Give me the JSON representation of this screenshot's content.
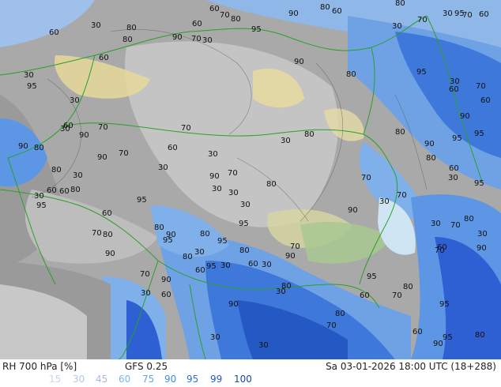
{
  "footer": {
    "title": "RH 700 hPa [%]",
    "model": "GFS 0.25",
    "valid_time": "Sa 03-01-2026 18:00 UTC (18+288)"
  },
  "legend": [
    {
      "label": "15",
      "color": "#c8d6ea"
    },
    {
      "label": "30",
      "color": "#b7c8e2"
    },
    {
      "label": "45",
      "color": "#a6bcdc"
    },
    {
      "label": "60",
      "color": "#7fb6ea"
    },
    {
      "label": "75",
      "color": "#5da6e8"
    },
    {
      "label": "90",
      "color": "#3f8ee0"
    },
    {
      "label": "95",
      "color": "#2f72d2"
    },
    {
      "label": "99",
      "color": "#2458c2"
    },
    {
      "label": "100",
      "color": "#1d44b0"
    }
  ],
  "palette": {
    "very_dry": "#d9d9d9",
    "dry": "#b8b8b8",
    "mid": "#9a9a9a",
    "moist": "#8fb8e8",
    "wet": "#4f86e0",
    "saturated": "#2e5fd3",
    "terrain_yellow": "#e8dca0",
    "terrain_green": "#a8c890",
    "borders": "#2aa02a"
  },
  "contour_labels": [
    "60",
    "70",
    "80",
    "90",
    "80",
    "60",
    "95",
    "60",
    "30",
    "60",
    "80",
    "90",
    "70",
    "30",
    "80",
    "70",
    "80",
    "30",
    "95",
    "70",
    "60",
    "30",
    "60",
    "90",
    "80",
    "95",
    "30",
    "60",
    "70",
    "30",
    "60",
    "30",
    "95",
    "90",
    "80",
    "90",
    "30",
    "80",
    "60",
    "70",
    "90",
    "70",
    "30",
    "95",
    "95",
    "90",
    "80",
    "70",
    "60",
    "90",
    "30",
    "80",
    "80",
    "60",
    "30",
    "70",
    "30",
    "90",
    "30",
    "95",
    "60",
    "80",
    "70",
    "30",
    "30",
    "60",
    "80",
    "30",
    "95",
    "70",
    "30",
    "30",
    "60",
    "90",
    "95",
    "80",
    "30",
    "70",
    "30",
    "80",
    "90",
    "80",
    "80",
    "95",
    "70",
    "90",
    "95",
    "60",
    "30",
    "80",
    "95",
    "90",
    "70",
    "80",
    "90",
    "70",
    "60",
    "95",
    "30",
    "60",
    "30",
    "70",
    "90",
    "95",
    "80",
    "70",
    "60",
    "30",
    "60",
    "80",
    "30",
    "90",
    "95",
    "80",
    "70",
    "60",
    "30",
    "90",
    "80",
    "95",
    "30"
  ]
}
